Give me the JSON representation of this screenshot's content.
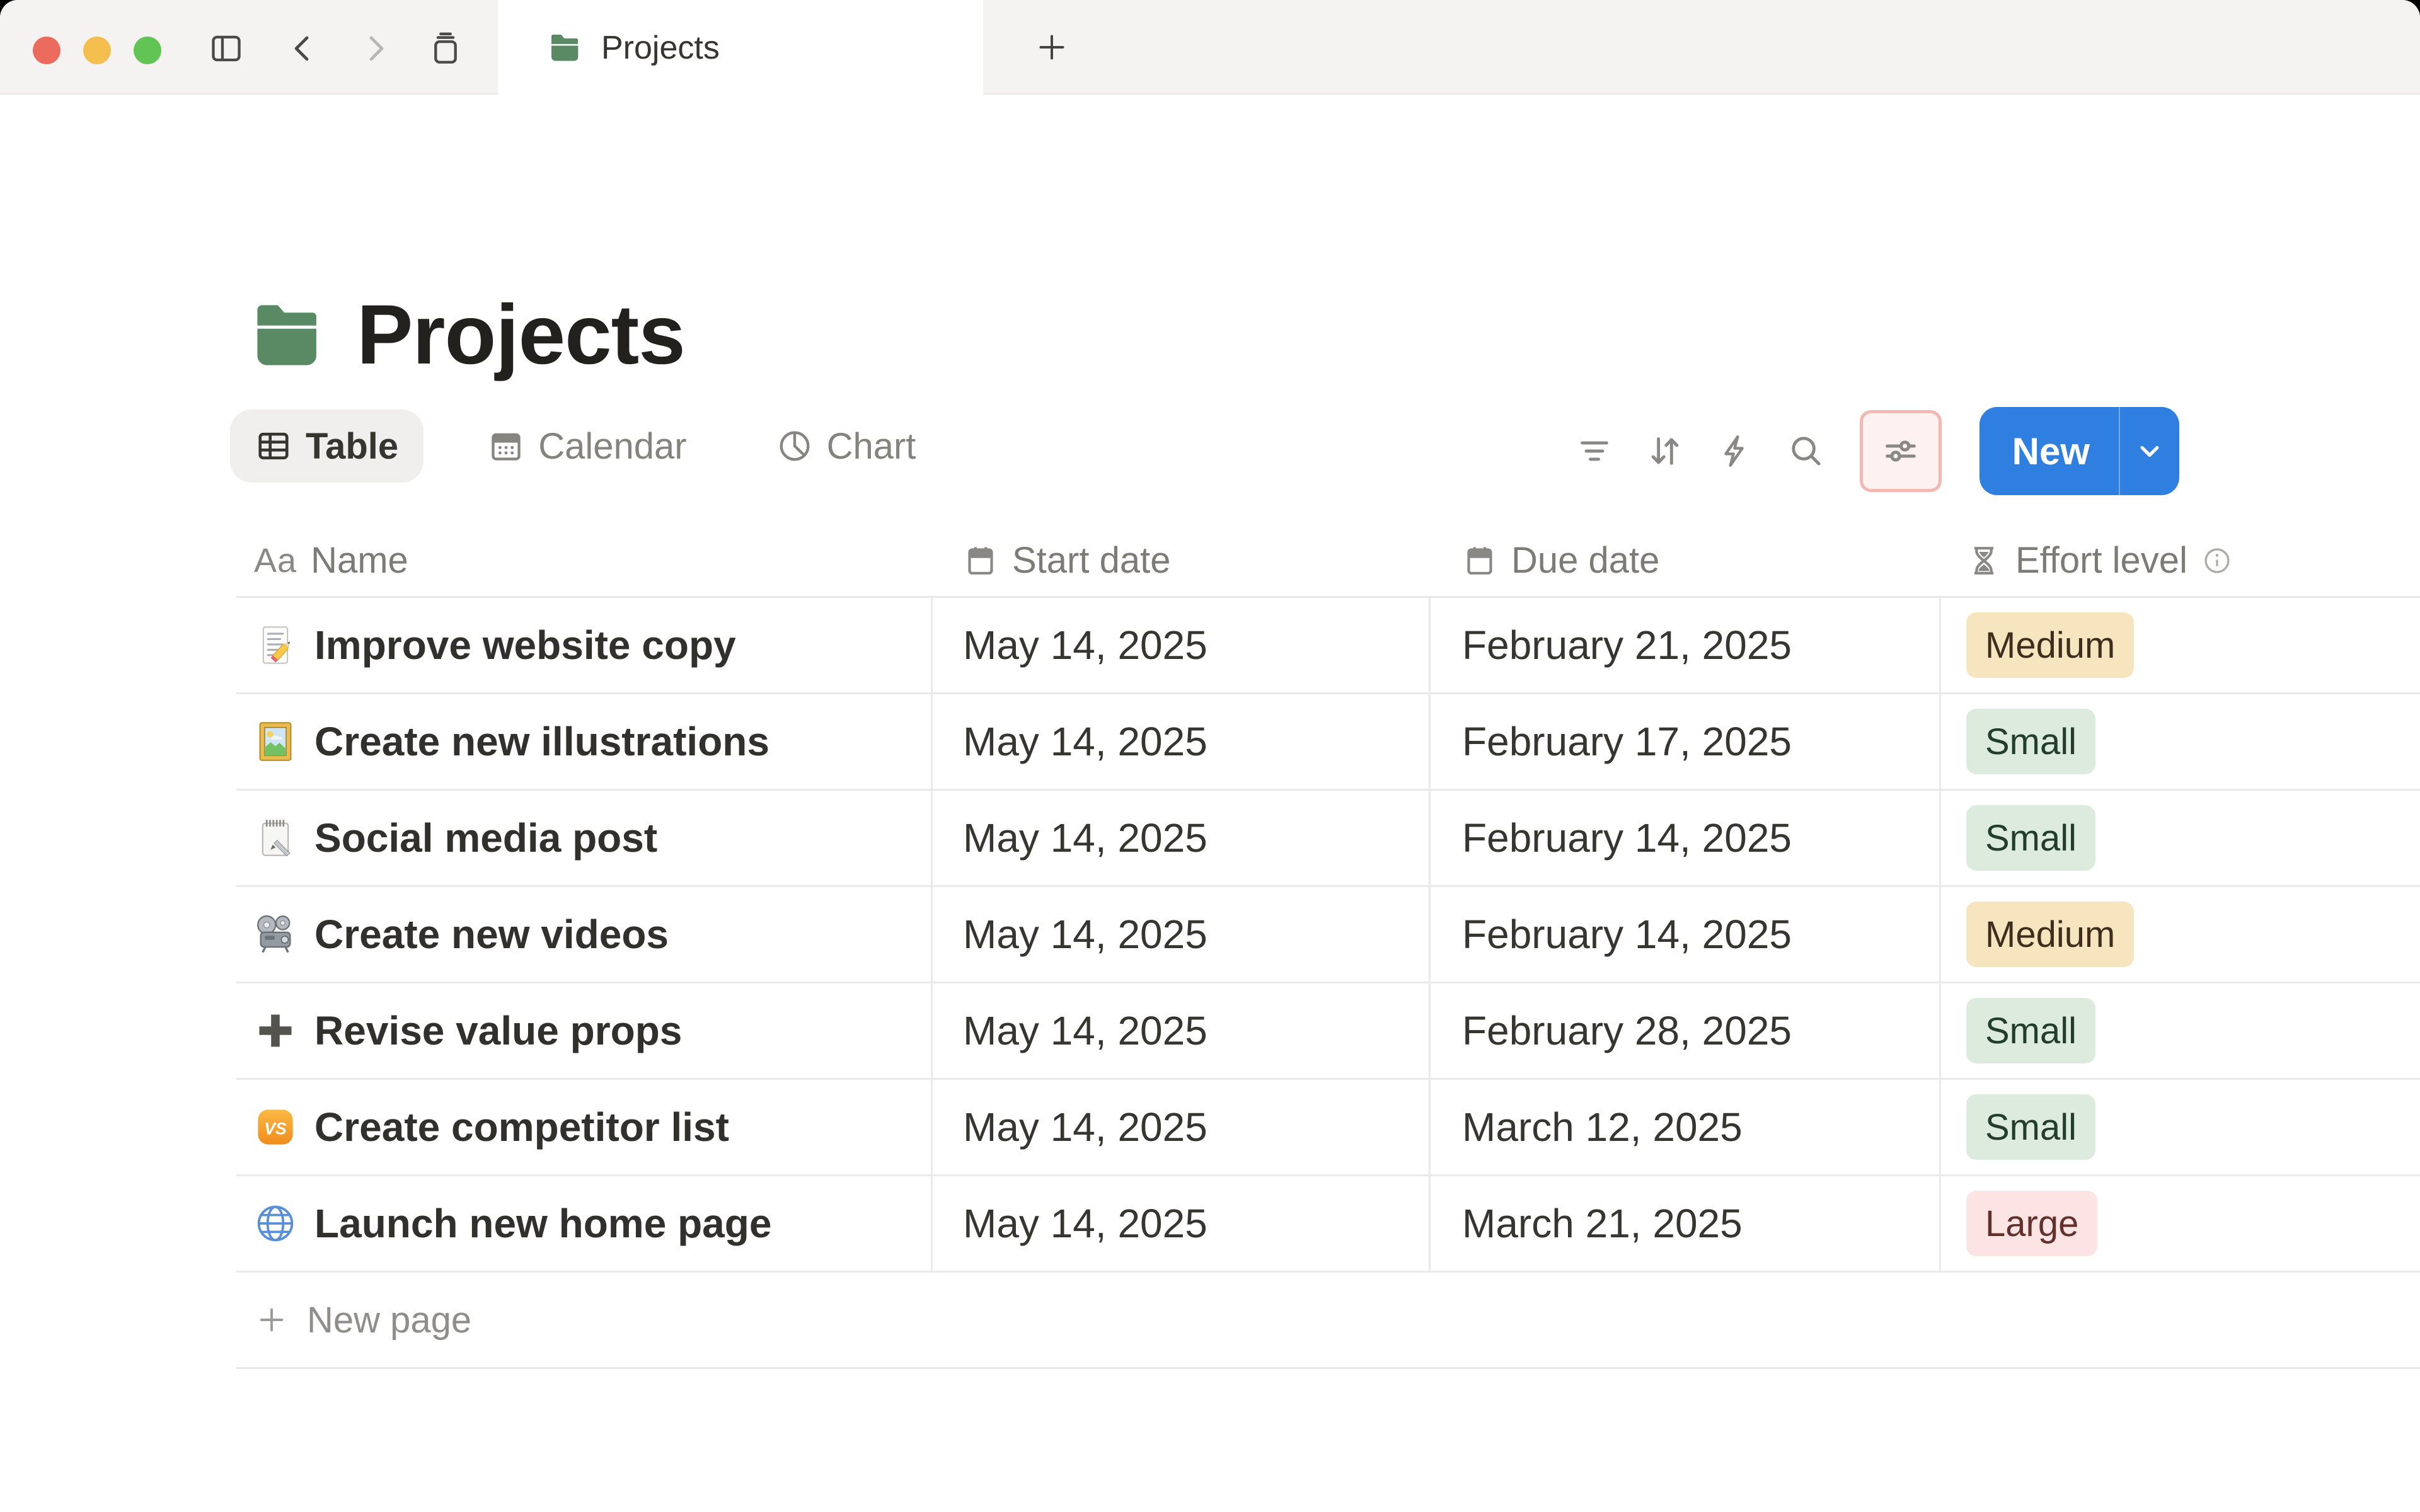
{
  "window": {
    "tab_title": "Projects",
    "traffic_lights": [
      "close",
      "minimize",
      "zoom"
    ],
    "nav_icons": [
      "sidebar-toggle",
      "back",
      "forward",
      "tab-stack"
    ],
    "new_tab_icon": "plus"
  },
  "page": {
    "title": "Projects",
    "icon": "green-folder"
  },
  "views": [
    {
      "label": "Table",
      "icon": "table-icon",
      "active": true
    },
    {
      "label": "Calendar",
      "icon": "calendar-icon",
      "active": false
    },
    {
      "label": "Chart",
      "icon": "pie-chart-icon",
      "active": false
    }
  ],
  "toolbar": {
    "icons": [
      "filter",
      "sort",
      "automations",
      "search",
      "view-settings"
    ],
    "view_settings_highlighted": true,
    "new_button": {
      "label": "New",
      "has_dropdown": true
    }
  },
  "table": {
    "columns": [
      {
        "label": "Name",
        "icon": "text-icon"
      },
      {
        "label": "Start date",
        "icon": "calendar-icon"
      },
      {
        "label": "Due date",
        "icon": "calendar-icon"
      },
      {
        "label": "Effort level",
        "icon": "hourglass-icon",
        "info_icon": true
      }
    ],
    "rows": [
      {
        "icon": "memo-pencil",
        "name": "Improve website copy",
        "start_date": "May 14, 2025",
        "due_date": "February 21, 2025",
        "effort": "Medium"
      },
      {
        "icon": "framed-picture",
        "name": "Create new illustrations",
        "start_date": "May 14, 2025",
        "due_date": "February 17, 2025",
        "effort": "Small"
      },
      {
        "icon": "spiral-notepad",
        "name": "Social media post",
        "start_date": "May 14, 2025",
        "due_date": "February 14, 2025",
        "effort": "Small"
      },
      {
        "icon": "film-projector",
        "name": "Create new videos",
        "start_date": "May 14, 2025",
        "due_date": "February 14, 2025",
        "effort": "Medium"
      },
      {
        "icon": "heavy-plus",
        "name": "Revise value props",
        "start_date": "May 14, 2025",
        "due_date": "February 28, 2025",
        "effort": "Small"
      },
      {
        "icon": "vs-badge",
        "name": "Create competitor list",
        "start_date": "May 14, 2025",
        "due_date": "March 12, 2025",
        "effort": "Small"
      },
      {
        "icon": "globe",
        "name": "Launch new home page",
        "start_date": "May 14, 2025",
        "due_date": "March 21, 2025",
        "effort": "Large"
      }
    ],
    "new_page_label": "New page"
  },
  "colors": {
    "accent_blue": "#2f7fe0",
    "highlight_border": "#f2b8b1",
    "highlight_bg": "#fdf2f0",
    "folder_green": "#598a64",
    "badge_medium_bg": "#f7e5c0",
    "badge_small_bg": "#dcebdd",
    "badge_large_bg": "#fbe4e3",
    "traffic_red": "#ec6a5e",
    "traffic_yellow": "#f5bf4f",
    "traffic_green": "#61c454"
  }
}
